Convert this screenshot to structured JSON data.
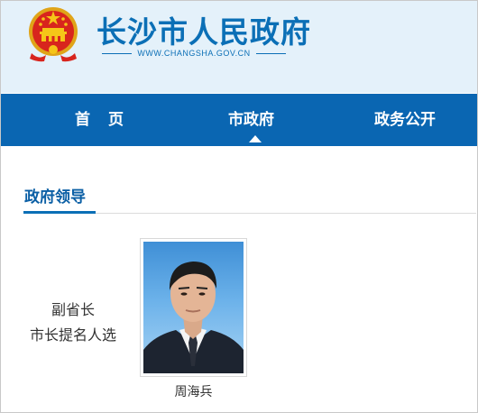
{
  "header": {
    "site_title": "长沙市人民政府",
    "site_url": "WWW.CHANGSHA.GOV.CN",
    "emblem_icon": "national-emblem-icon"
  },
  "nav": {
    "items": [
      {
        "label": "首页"
      },
      {
        "label": "市政府"
      },
      {
        "label": "政务公开"
      }
    ],
    "active_index": 1
  },
  "section": {
    "title": "政府领导"
  },
  "leader": {
    "role_line1": "副省长",
    "role_line2": "市长提名人选",
    "name": "周海兵"
  },
  "colors": {
    "brand_blue": "#0a66b2",
    "header_bg": "#e4f1fa",
    "emblem_red": "#d8251d",
    "emblem_gold": "#f5c518"
  }
}
